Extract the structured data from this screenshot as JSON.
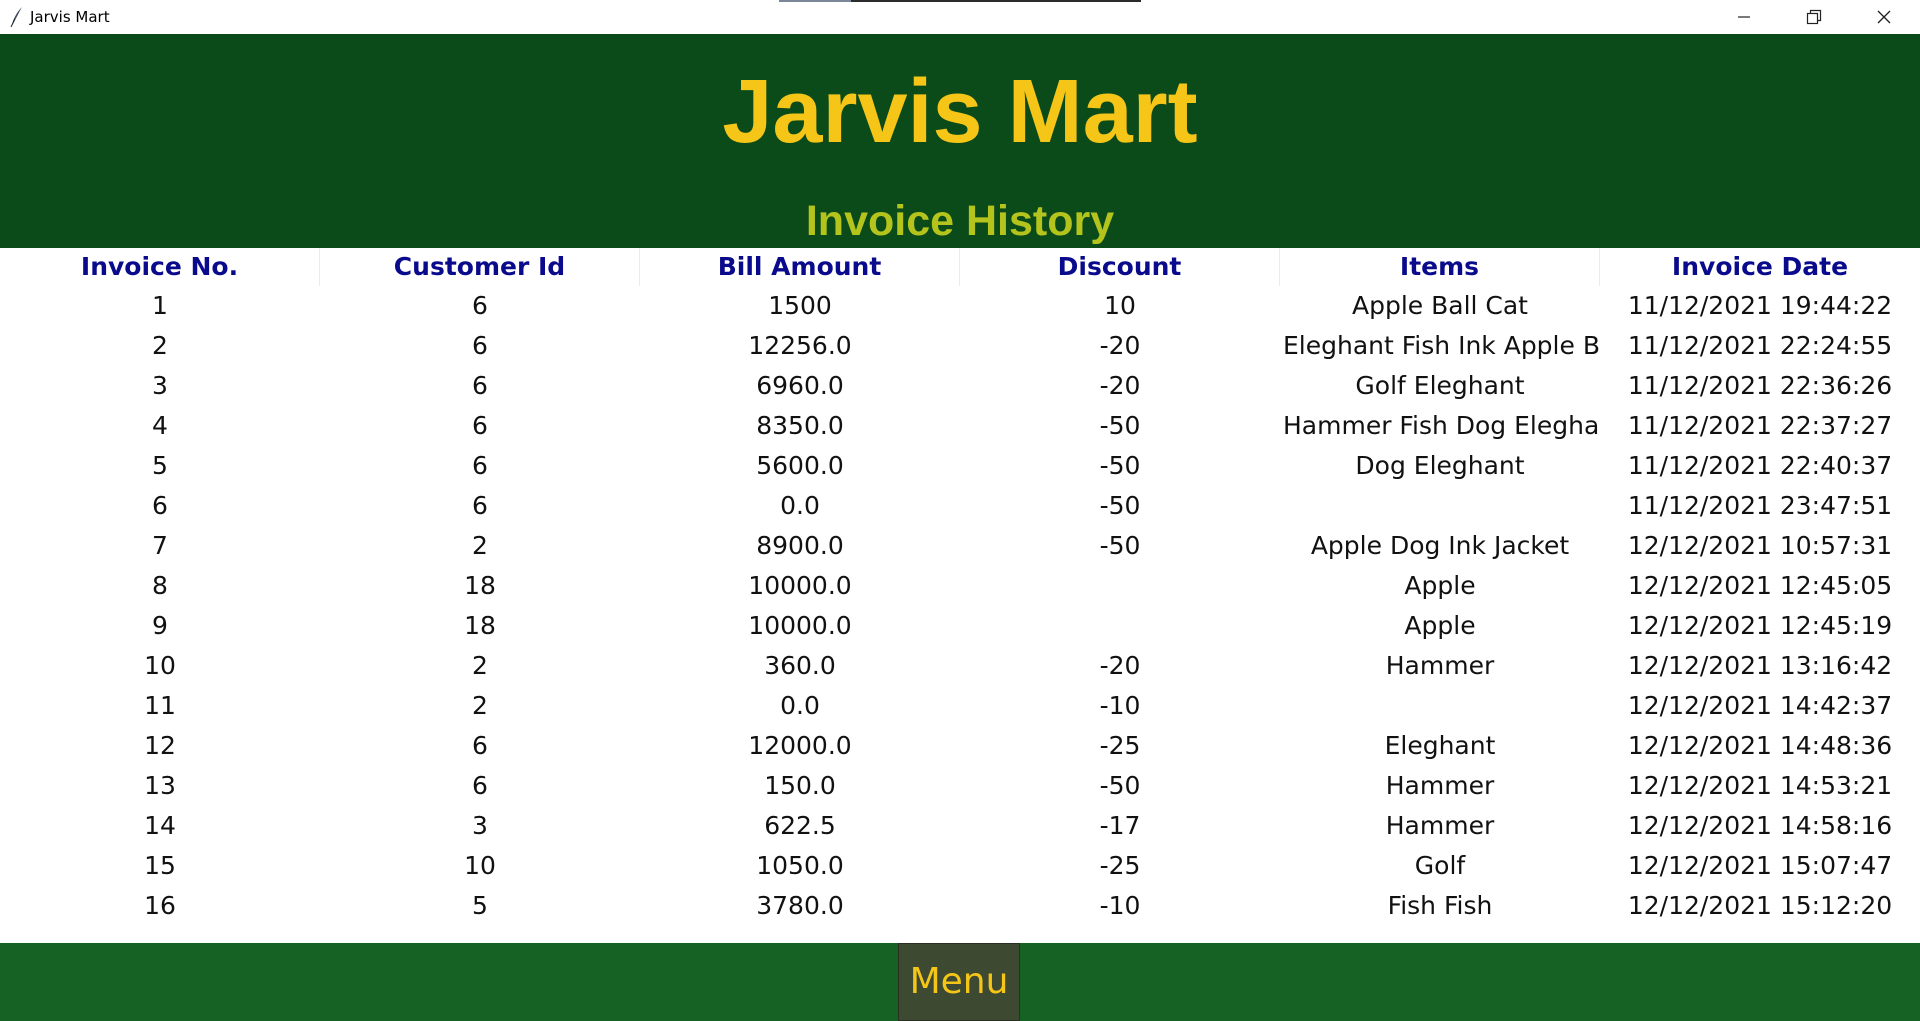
{
  "window": {
    "title": "Jarvis Mart",
    "controls": [
      "minimize-icon",
      "restore-icon",
      "close-icon"
    ]
  },
  "header": {
    "brand": "Jarvis Mart",
    "subtitle": "Invoice History"
  },
  "table": {
    "columns": [
      "Invoice No.",
      "Customer Id",
      "Bill Amount",
      "Discount",
      "Items",
      "Invoice Date"
    ],
    "rows": [
      [
        "1",
        "6",
        "1500",
        "10",
        "Apple Ball Cat",
        "11/12/2021 19:44:22"
      ],
      [
        "2",
        "6",
        "12256.0",
        "-20",
        "Eleghant Fish Ink Apple Ba",
        "11/12/2021 22:24:55"
      ],
      [
        "3",
        "6",
        "6960.0",
        "-20",
        "Golf Eleghant",
        "11/12/2021 22:36:26"
      ],
      [
        "4",
        "6",
        "8350.0",
        "-50",
        "Hammer Fish Dog Eleghar",
        "11/12/2021 22:37:27"
      ],
      [
        "5",
        "6",
        "5600.0",
        "-50",
        "Dog Eleghant",
        "11/12/2021 22:40:37"
      ],
      [
        "6",
        "6",
        "0.0",
        "-50",
        "",
        "11/12/2021 23:47:51"
      ],
      [
        "7",
        "2",
        "8900.0",
        "-50",
        "Apple Dog Ink Jacket",
        "12/12/2021 10:57:31"
      ],
      [
        "8",
        "18",
        "10000.0",
        "",
        "Apple",
        "12/12/2021 12:45:05"
      ],
      [
        "9",
        "18",
        "10000.0",
        "",
        "Apple",
        "12/12/2021 12:45:19"
      ],
      [
        "10",
        "2",
        "360.0",
        "-20",
        "Hammer",
        "12/12/2021 13:16:42"
      ],
      [
        "11",
        "2",
        "0.0",
        "-10",
        "",
        "12/12/2021 14:42:37"
      ],
      [
        "12",
        "6",
        "12000.0",
        "-25",
        "Eleghant",
        "12/12/2021 14:48:36"
      ],
      [
        "13",
        "6",
        "150.0",
        "-50",
        "Hammer",
        "12/12/2021 14:53:21"
      ],
      [
        "14",
        "3",
        "622.5",
        "-17",
        "Hammer",
        "12/12/2021 14:58:16"
      ],
      [
        "15",
        "10",
        "1050.0",
        "-25",
        "Golf",
        "12/12/2021 15:07:47"
      ],
      [
        "16",
        "5",
        "3780.0",
        "-10",
        "Fish Fish",
        "12/12/2021 15:12:20"
      ]
    ]
  },
  "footer": {
    "menu_label": "Menu"
  },
  "colors": {
    "header_bg": "#0b4a19",
    "brand": "#f5c518",
    "subtitle": "#b5c41d",
    "column_header": "#0a0a8c",
    "footer_bg": "#166124",
    "menu_bg": "#3d4a31"
  }
}
